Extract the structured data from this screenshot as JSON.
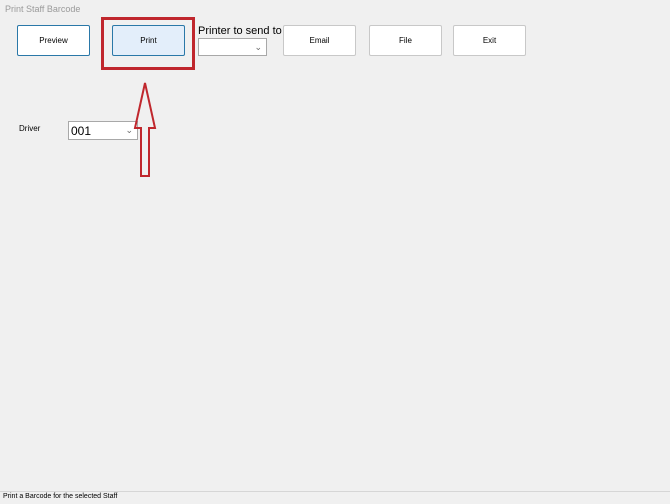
{
  "window": {
    "title": "Print Staff Barcode"
  },
  "toolbar": {
    "preview_label": "Preview",
    "print_label": "Print",
    "email_label": "Email",
    "file_label": "File",
    "exit_label": "Exit",
    "printer_label": "Printer to send to",
    "printer_value": ""
  },
  "form": {
    "driver_label": "Driver",
    "driver_value": "001"
  },
  "annotation": {
    "highlight_color": "#c0272d",
    "arrow_direction": "up"
  },
  "status": {
    "text": "Print a Barcode for the selected Staff"
  },
  "icons": {
    "dropdown": "chevron-down-icon"
  }
}
